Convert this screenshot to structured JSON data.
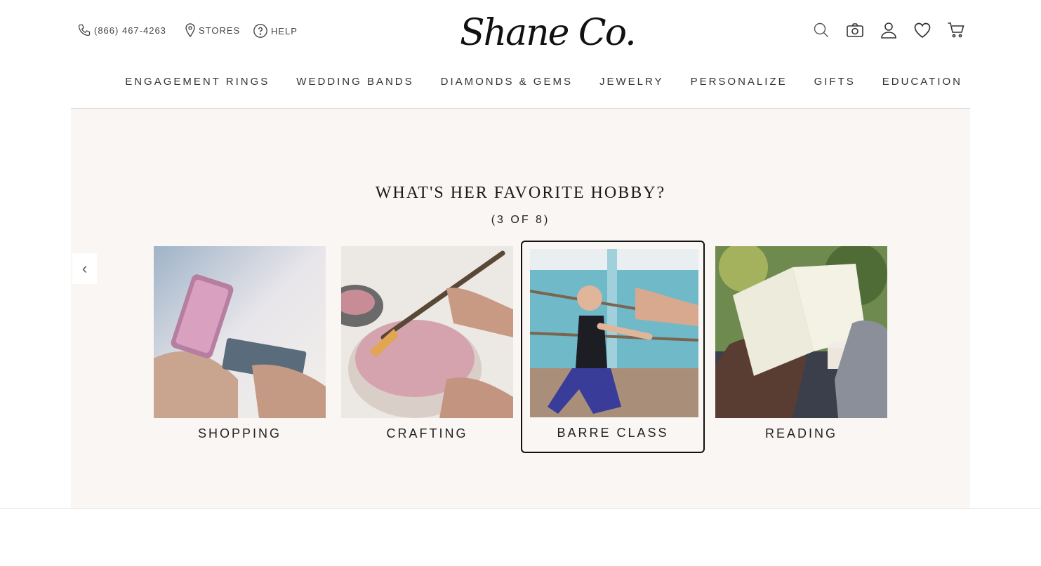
{
  "header": {
    "phone": "(866) 467-4263",
    "stores": "STORES",
    "help": "HELP",
    "logo_text": "Shane Co.",
    "logo_reg": "®",
    "icons": [
      "search-icon",
      "camera-icon",
      "account-icon",
      "heart-icon",
      "cart-icon"
    ]
  },
  "nav": {
    "items": [
      "ENGAGEMENT RINGS",
      "WEDDING BANDS",
      "DIAMONDS & GEMS",
      "JEWELRY",
      "PERSONALIZE",
      "GIFTS",
      "EDUCATION"
    ]
  },
  "quiz": {
    "title": "WHAT'S HER FAVORITE HOBBY?",
    "progress": "(3 OF 8)",
    "prev_glyph": "‹",
    "options": [
      {
        "label": "SHOPPING",
        "selected": false
      },
      {
        "label": "CRAFTING",
        "selected": false
      },
      {
        "label": "BARRE CLASS",
        "selected": true
      },
      {
        "label": "READING",
        "selected": false
      }
    ]
  },
  "colors": {
    "panel_bg": "#f9f6f3",
    "selected_border": "#111111",
    "text": "#333333"
  }
}
